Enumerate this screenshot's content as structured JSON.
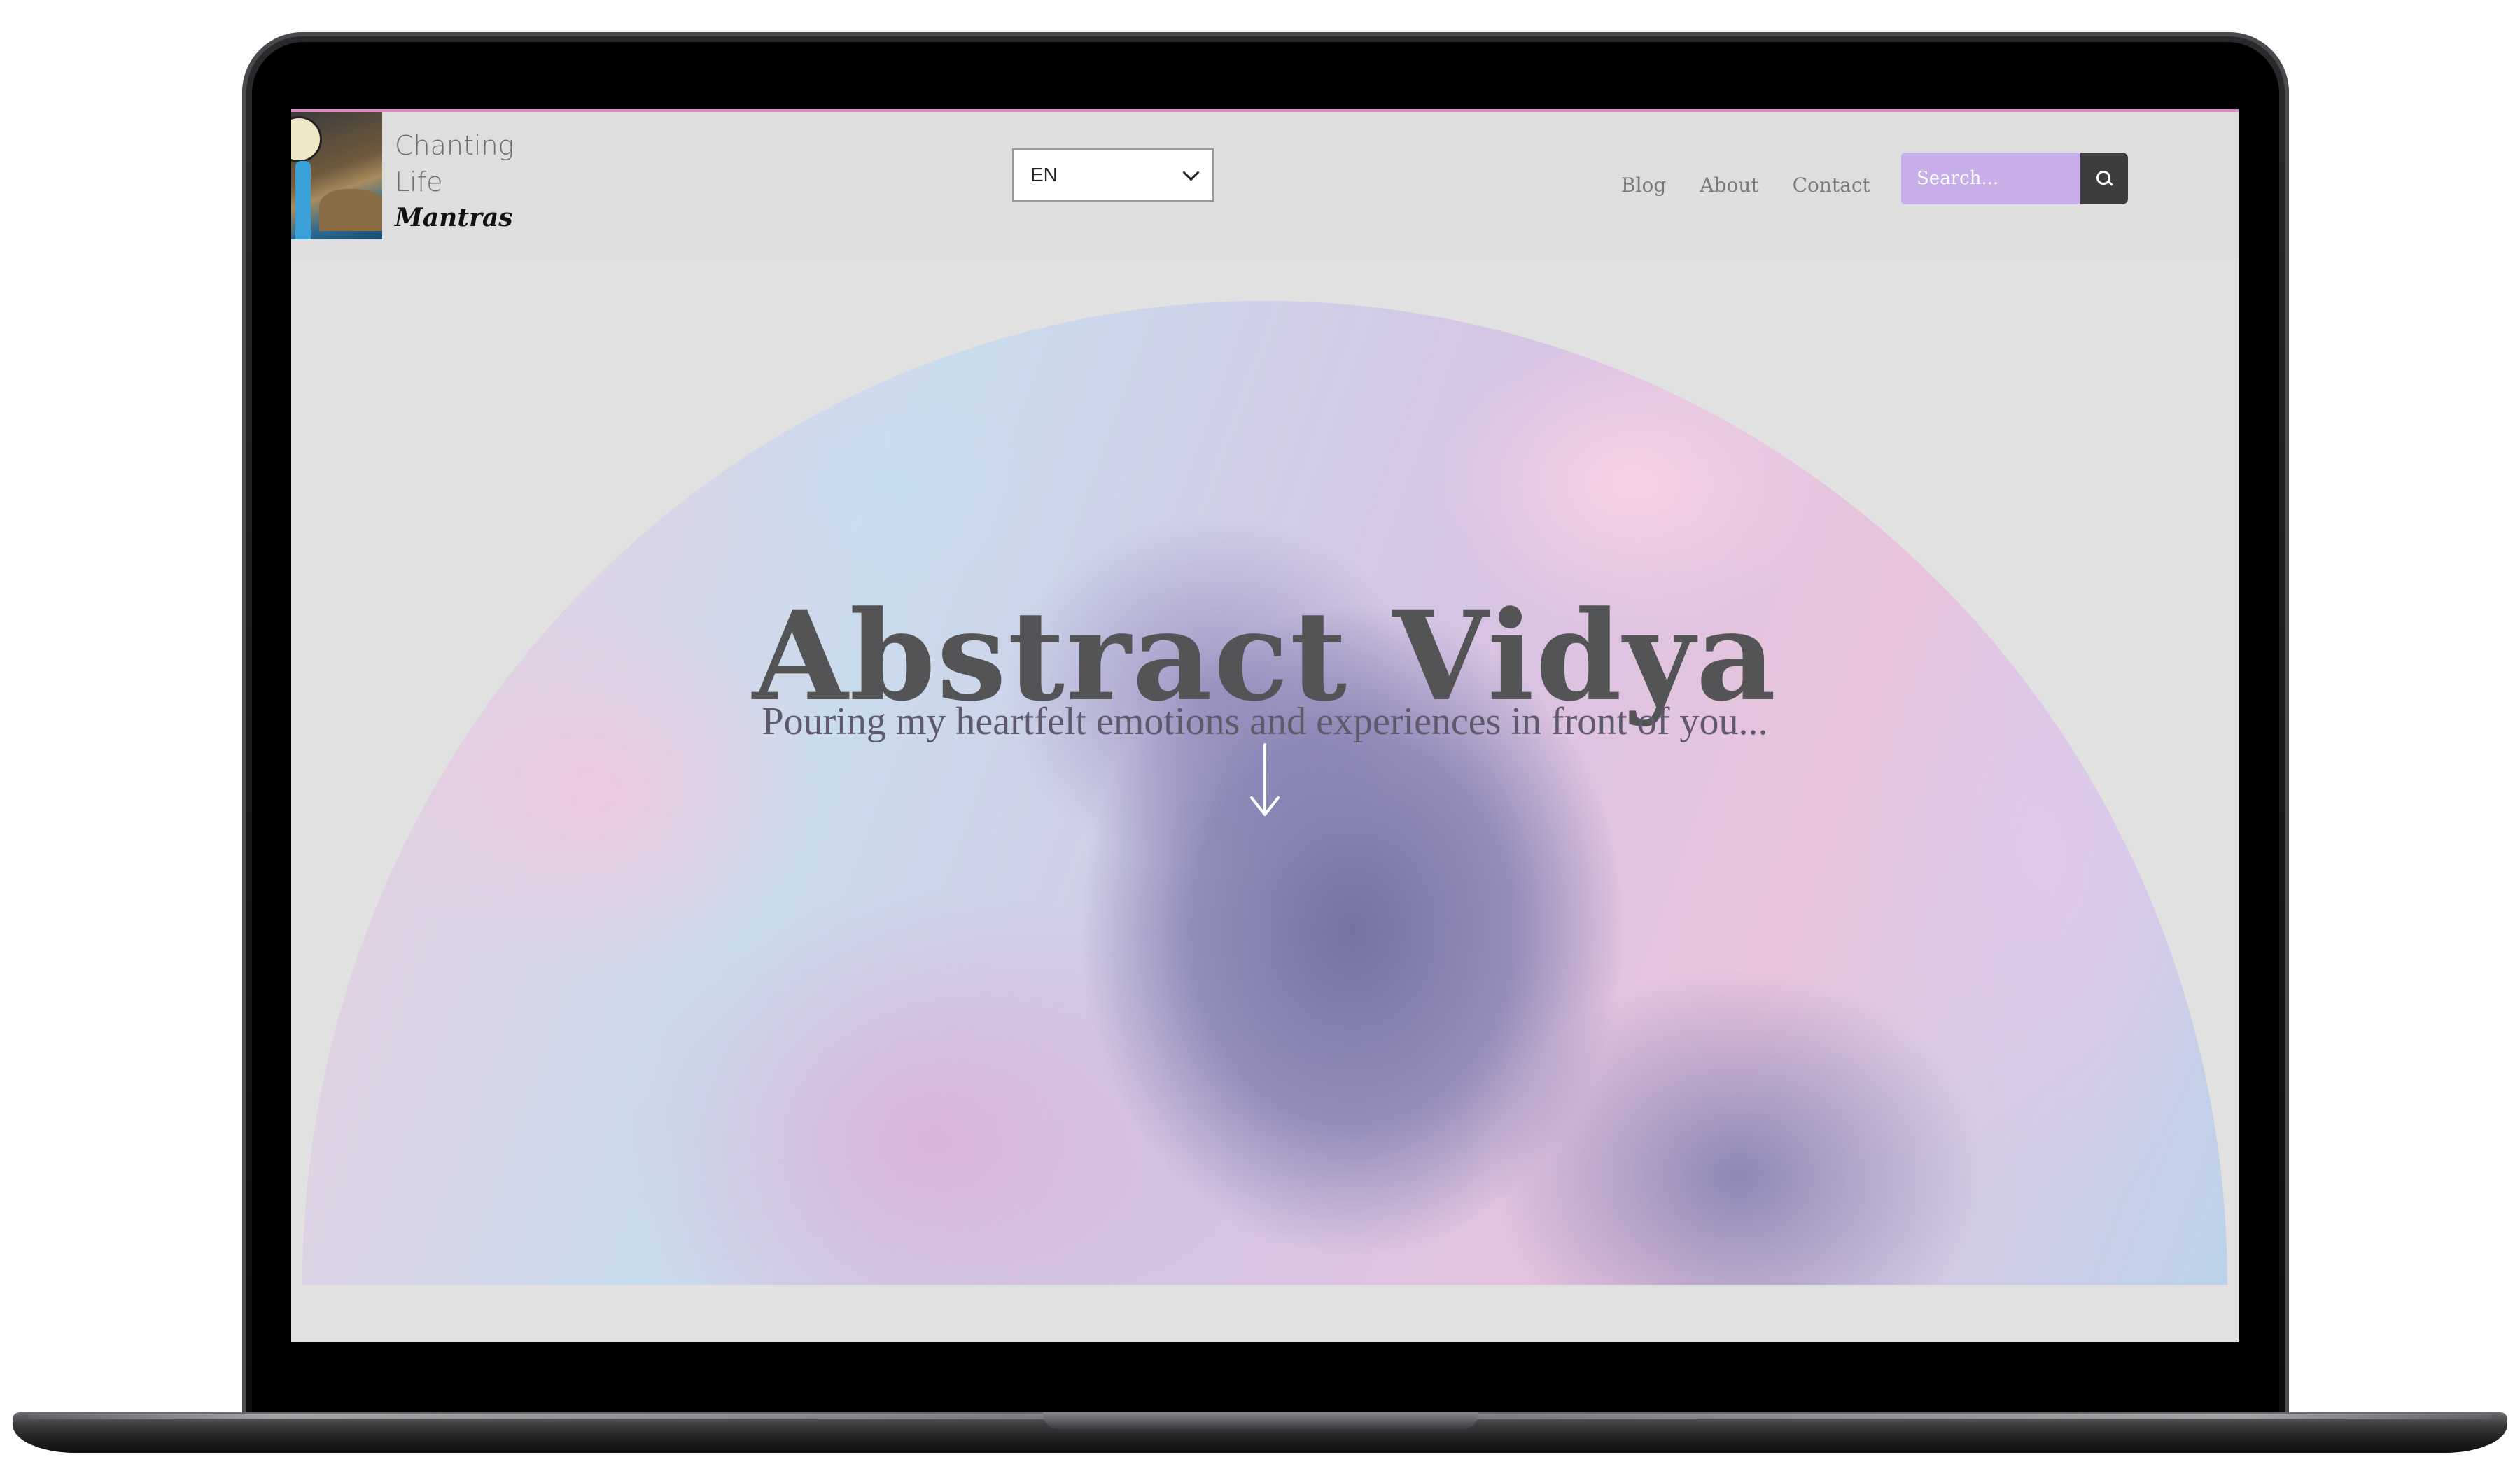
{
  "site": {
    "logo_lines": [
      "Chanting",
      "Life"
    ],
    "logo_mantras": "Mantras"
  },
  "header": {
    "language": {
      "selected": "EN"
    },
    "nav": [
      "Blog",
      "About",
      "Contact"
    ],
    "search": {
      "placeholder": "Search..."
    }
  },
  "hero": {
    "title": "Abstract Vidya",
    "subtitle": "Pouring my heartfelt emotions and experiences in front of you..."
  },
  "icons": {
    "search": "search-icon",
    "dropdown": "chevron-down-icon",
    "scroll": "arrow-down-icon"
  },
  "colors": {
    "accent_search": "#c7aee8",
    "search_button": "#3d3d3f",
    "top_border": "#d88bc6",
    "page_background": "#e1e1e1",
    "title_text": "#545457"
  }
}
